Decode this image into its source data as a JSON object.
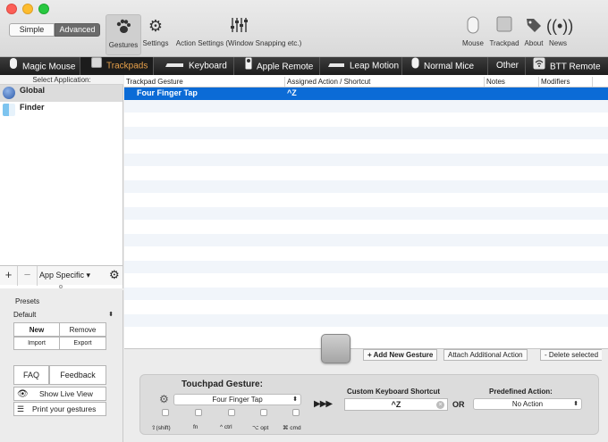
{
  "toolbar": {
    "mode_simple": "Simple",
    "mode_advanced": "Advanced",
    "gestures": "Gestures",
    "settings": "Settings",
    "action_settings": "Action Settings (Window Snapping etc.)",
    "mouse": "Mouse",
    "trackpad": "Trackpad",
    "about": "About",
    "news": "News"
  },
  "devices": {
    "magic_mouse": "Magic Mouse",
    "trackpads": "Trackpads",
    "keyboard": "Keyboard",
    "apple_remote": "Apple Remote",
    "leap_motion": "Leap Motion",
    "normal_mice": "Normal Mice",
    "other": "Other",
    "btt_remote": "BTT Remote"
  },
  "sidebar": {
    "header": "Select Application:",
    "apps": [
      "Global",
      "Finder"
    ],
    "app_specific": "App Specific"
  },
  "presets": {
    "title": "Presets",
    "selected": "Default",
    "new": "New",
    "remove": "Remove",
    "import": "Import",
    "export": "Export"
  },
  "help": {
    "faq": "FAQ",
    "feedback": "Feedback",
    "live_view": "Show Live View",
    "print": "Print your gestures"
  },
  "table": {
    "headers": [
      "Trackpad Gesture",
      "Assigned Action / Shortcut",
      "Notes",
      "Modifiers"
    ],
    "rows": [
      {
        "gesture": "Four Finger Tap",
        "action": "^Z",
        "notes": "",
        "modifiers": ""
      }
    ]
  },
  "gesture_actions": {
    "add": "+ Add New Gesture",
    "attach": "Attach Additional Action",
    "delete": "- Delete selected"
  },
  "config": {
    "gesture_title": "Touchpad Gesture:",
    "gesture_value": "Four Finger Tap",
    "modifiers": [
      "⇧(shift)",
      "fn",
      "^ ctrl",
      "⌥ opt",
      "⌘ cmd"
    ],
    "arrows": "▶▶▶",
    "shortcut_title": "Custom Keyboard Shortcut",
    "shortcut_value": "^Z",
    "or": "OR",
    "predefined_title": "Predefined Action:",
    "predefined_value": "No Action"
  },
  "colors": {
    "selection": "#0b6bd6",
    "device_selected_text": "#e8a14a"
  }
}
